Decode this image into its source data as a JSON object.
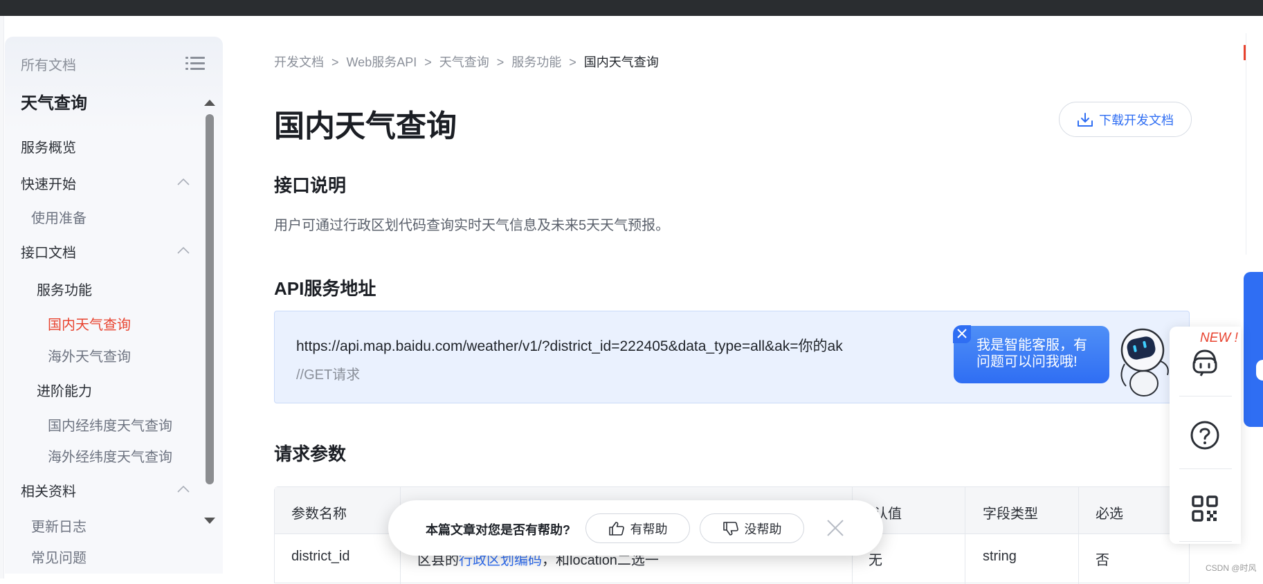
{
  "sidebar": {
    "all_docs": "所有文档",
    "title": "天气查询",
    "items": [
      {
        "label": "服务概览"
      },
      {
        "label": "快速开始"
      },
      {
        "label": "使用准备"
      },
      {
        "label": "接口文档"
      },
      {
        "label": "服务功能"
      },
      {
        "label": "国内天气查询"
      },
      {
        "label": "海外天气查询"
      },
      {
        "label": "进阶能力"
      },
      {
        "label": "国内经纬度天气查询"
      },
      {
        "label": "海外经纬度天气查询"
      },
      {
        "label": "相关资料"
      },
      {
        "label": "更新日志"
      },
      {
        "label": "常见问题"
      }
    ]
  },
  "breadcrumb": [
    "开发文档",
    "Web服务API",
    "天气查询",
    "服务功能",
    "国内天气查询"
  ],
  "breadcrumb_sep": ">",
  "page_title": "国内天气查询",
  "download_button": "下载开发文档",
  "section_interface": {
    "heading": "接口说明",
    "text": "用户可通过行政区划代码查询实时天气信息及未来5天天气预报。"
  },
  "section_api": {
    "heading": "API服务地址",
    "url": "https://api.map.baidu.com/weather/v1/?district_id=222405&data_type=all&ak=你的ak",
    "comment": "//GET请求"
  },
  "section_params": {
    "heading": "请求参数",
    "columns": [
      "参数名称",
      "",
      "默认值",
      "字段类型",
      "必选"
    ],
    "row": {
      "name": "district_id",
      "desc_prefix": "区县的",
      "desc_link": "行政区划编码",
      "desc_suffix": "，和location二选一",
      "default": "无",
      "type": "string",
      "required": "否"
    }
  },
  "feedback": {
    "question": "本篇文章对您是否有帮助?",
    "helpful": "有帮助",
    "not_helpful": "没帮助"
  },
  "chat_bubble": {
    "line1": "我是智能客服，有",
    "line2": "问题可以问我哦!"
  },
  "right_panel": {
    "new_badge": "NEW !"
  },
  "watermark": "CSDN @时风",
  "colors": {
    "accent": "#2f6ef3",
    "active": "#e8432f",
    "topbar": "#2a2d30"
  }
}
